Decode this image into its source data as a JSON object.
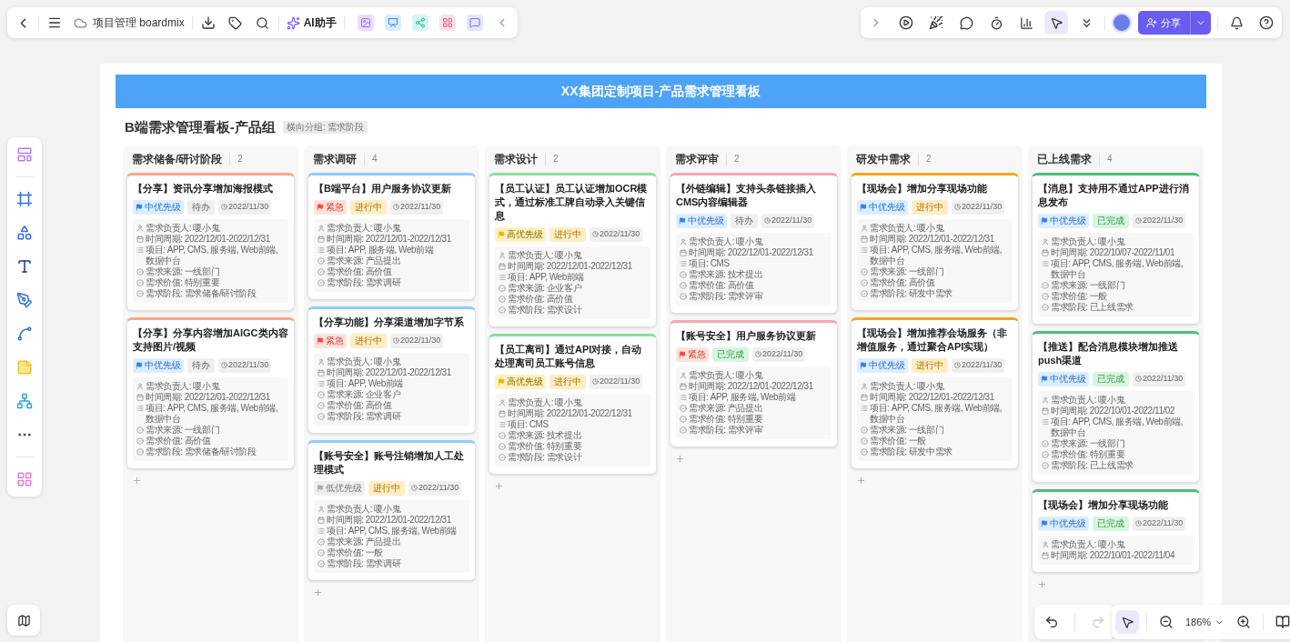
{
  "toolbar": {
    "file_name": "项目管理 boardmix",
    "ai_label": "AI助手",
    "share_label": "分享"
  },
  "board": {
    "title": "XX集团定制项目-产品需求管理看板",
    "subtitle": "B端需求管理看板-产品组",
    "grouping_tag": "横向分组: 需求阶段",
    "columns": [
      {
        "name": "需求储备/研讨阶段",
        "count": "2",
        "color": "#f9a88a",
        "cards": [
          {
            "title": "【分享】资讯分享增加海报模式",
            "priority": {
              "kind": "medium",
              "text": "中优先级"
            },
            "status": {
              "kind": "todo",
              "text": "待办"
            },
            "date": "2022/11/30",
            "lines": [
              "需求负责人: 嗄小鬼",
              "时间周期: 2022/12/01-2022/12/31",
              "项目: APP, CMS, 服务端, Web前端, 数据中台",
              "需求来源: 一线部门",
              "需求价值: 特别重要",
              "需求阶段: 需求储备/研讨阶段"
            ]
          },
          {
            "title": "【分享】分享内容增加AIGC类内容支持图片/视频",
            "priority": {
              "kind": "medium",
              "text": "中优先级"
            },
            "status": {
              "kind": "todo",
              "text": "待办"
            },
            "date": "2022/11/30",
            "lines": [
              "需求负责人: 嗄小鬼",
              "时间周期: 2022/12/01-2022/12/31",
              "项目: APP, CMS, 服务端, Web前端, 数据中台",
              "需求来源: 一线部门",
              "需求价值: 高价值",
              "需求阶段: 需求储备/研讨阶段"
            ]
          }
        ]
      },
      {
        "name": "需求调研",
        "count": "4",
        "color": "#8ecdf8",
        "cards": [
          {
            "title": "【B端平台】用户服务协议更新",
            "priority": {
              "kind": "urgent",
              "text": "紧急"
            },
            "status": {
              "kind": "doing",
              "text": "进行中"
            },
            "date": "2022/11/30",
            "lines": [
              "需求负责人: 嗄小鬼",
              "时间周期: 2022/12/01-2022/12/31",
              "项目: APP, 服务端, Web前端",
              "需求来源: 产品提出",
              "需求价值: 高价值",
              "需求阶段: 需求调研"
            ]
          },
          {
            "title": "【分享功能】分享渠道增加字节系",
            "priority": {
              "kind": "urgent",
              "text": "紧急"
            },
            "status": {
              "kind": "doing",
              "text": "进行中"
            },
            "date": "2022/11/30",
            "lines": [
              "需求负责人: 嗄小鬼",
              "时间周期: 2022/12/01-2022/12/31",
              "项目: APP, Web前端",
              "需求来源: 企业客户",
              "需求价值: 高价值",
              "需求阶段: 需求调研"
            ]
          },
          {
            "title": "【账号安全】账号注销增加人工处理模式",
            "priority": {
              "kind": "low",
              "text": "低优先级"
            },
            "status": {
              "kind": "doing",
              "text": "进行中"
            },
            "date": "2022/11/30",
            "lines": [
              "需求负责人: 嗄小鬼",
              "时间周期: 2022/12/01-2022/12/31",
              "项目: APP, CMS, 服务端, Web前端",
              "需求来源: 产品提出",
              "需求价值: 一般",
              "需求阶段: 需求调研"
            ]
          }
        ]
      },
      {
        "name": "需求设计",
        "count": "2",
        "color": "#88e0a0",
        "cards": [
          {
            "title": "【员工认证】员工认证增加OCR模式，通过标准工牌自动录入关键信息",
            "priority": {
              "kind": "high",
              "text": "高优先级"
            },
            "status": {
              "kind": "doing",
              "text": "进行中"
            },
            "date": "2022/11/30",
            "lines": [
              "需求负责人: 嗄小鬼",
              "时间周期: 2022/12/01-2022/12/31",
              "项目: APP, Web前端",
              "需求来源: 企业客户",
              "需求价值: 高价值",
              "需求阶段: 需求设计"
            ]
          },
          {
            "title": "【员工离司】通过API对接，自动处理离司员工账号信息",
            "priority": {
              "kind": "high",
              "text": "高优先级"
            },
            "status": {
              "kind": "doing",
              "text": "进行中"
            },
            "date": "2022/11/30",
            "lines": [
              "需求负责人: 嗄小鬼",
              "时间周期: 2022/12/01-2022/12/31",
              "项目: CMS",
              "需求来源: 技术提出",
              "需求价值: 特别重要",
              "需求阶段: 需求设计"
            ]
          }
        ]
      },
      {
        "name": "需求评审",
        "count": "2",
        "color": "#f7a6b5",
        "cards": [
          {
            "title": "【外链编辑】支持头条链接插入CMS内容编辑器",
            "priority": {
              "kind": "medium",
              "text": "中优先级"
            },
            "status": {
              "kind": "todo",
              "text": "待办"
            },
            "date": "2022/11/30",
            "lines": [
              "需求负责人: 嗄小鬼",
              "时间周期: 2022/12/01-2022/12/31",
              "项目: CMS",
              "需求来源: 技术提出",
              "需求价值: 高价值",
              "需求阶段: 需求评审"
            ]
          },
          {
            "title": "【账号安全】用户服务协议更新",
            "priority": {
              "kind": "urgent",
              "text": "紧急"
            },
            "status": {
              "kind": "done",
              "text": "已完成"
            },
            "date": "2022/11/30",
            "lines": [
              "需求负责人: 嗄小鬼",
              "时间周期: 2022/12/01-2022/12/31",
              "项目: APP, 服务端, Web前端",
              "需求来源: 产品提出",
              "需求价值: 特别重要",
              "需求阶段: 需求评审"
            ]
          }
        ]
      },
      {
        "name": "研发中需求",
        "count": "2",
        "color": "#f5a623",
        "cards": [
          {
            "title": "【现场会】增加分享现场功能",
            "priority": {
              "kind": "medium",
              "text": "中优先级"
            },
            "status": {
              "kind": "doing",
              "text": "进行中"
            },
            "date": "2022/11/30",
            "lines": [
              "需求负责人: 嗄小鬼",
              "时间周期: 2022/12/01-2022/12/31",
              "项目: APP, CMS, 服务端, Web前端, 数据中台",
              "需求来源: 一线部门",
              "需求价值: 高价值",
              "需求阶段: 研发中需求"
            ]
          },
          {
            "title": "【现场会】增加推荐会场服务（非增值服务，通过聚合API实现）",
            "priority": {
              "kind": "medium",
              "text": "中优先级"
            },
            "status": {
              "kind": "doing",
              "text": "进行中"
            },
            "date": "2022/11/30",
            "lines": [
              "需求负责人: 嗄小鬼",
              "时间周期: 2022/12/01-2022/12/31",
              "项目: APP, CMS, 服务端, Web前端, 数据中台",
              "需求来源: 一线部门",
              "需求价值: 一般",
              "需求阶段: 研发中需求"
            ]
          }
        ]
      },
      {
        "name": "已上线需求",
        "count": "4",
        "color": "#4cbf7a",
        "cards": [
          {
            "title": "【消息】支持用不通过APP进行消息发布",
            "priority": {
              "kind": "medium",
              "text": "中优先级"
            },
            "status": {
              "kind": "done",
              "text": "已完成"
            },
            "date": "2022/11/30",
            "lines": [
              "需求负责人: 嗄小鬼",
              "时间周期: 2022/10/07-2022/11/01",
              "项目: APP, CMS, 服务端, Web前端, 数据中台",
              "需求来源: 一线部门",
              "需求价值: 一般",
              "需求阶段: 已上线需求"
            ]
          },
          {
            "title": "【推送】配合消息模块增加推送push渠道",
            "priority": {
              "kind": "medium",
              "text": "中优先级"
            },
            "status": {
              "kind": "done",
              "text": "已完成"
            },
            "date": "2022/11/30",
            "lines": [
              "需求负责人: 嗄小鬼",
              "时间周期: 2022/10/01-2022/11/02",
              "项目: APP, CMS, 服务端, Web前端, 数据中台",
              "需求来源: 一线部门",
              "需求价值: 特别重要",
              "需求阶段: 已上线需求"
            ]
          },
          {
            "title": "【现场会】增加分享现场功能",
            "priority": {
              "kind": "medium",
              "text": "中优先级"
            },
            "status": {
              "kind": "done",
              "text": "已完成"
            },
            "date": "2022/11/30",
            "lines": [
              "需求负责人: 嗄小鬼",
              "时间周期: 2022/10/01-2022/11/04"
            ]
          }
        ]
      }
    ]
  },
  "zoom": {
    "level_text": "186%"
  }
}
